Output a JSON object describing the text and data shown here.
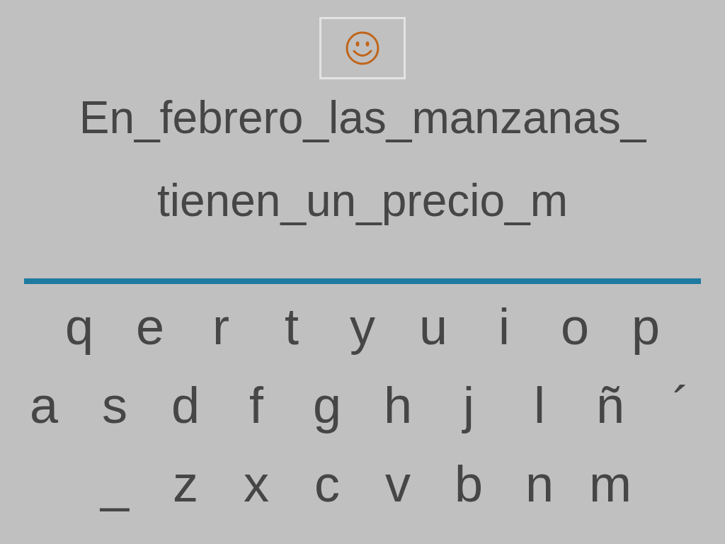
{
  "prompt_lines": [
    "En_febrero_las_manzanas_",
    "tienen_un_precio_m"
  ],
  "keyboard_rows": [
    [
      "q",
      "e",
      "r",
      "t",
      "y",
      "u",
      "i",
      "o",
      "p"
    ],
    [
      "a",
      "s",
      "d",
      "f",
      "g",
      "h",
      "j",
      "l",
      "ñ",
      "´"
    ],
    [
      "_",
      "z",
      "x",
      "c",
      "v",
      "b",
      "n",
      "m"
    ]
  ]
}
